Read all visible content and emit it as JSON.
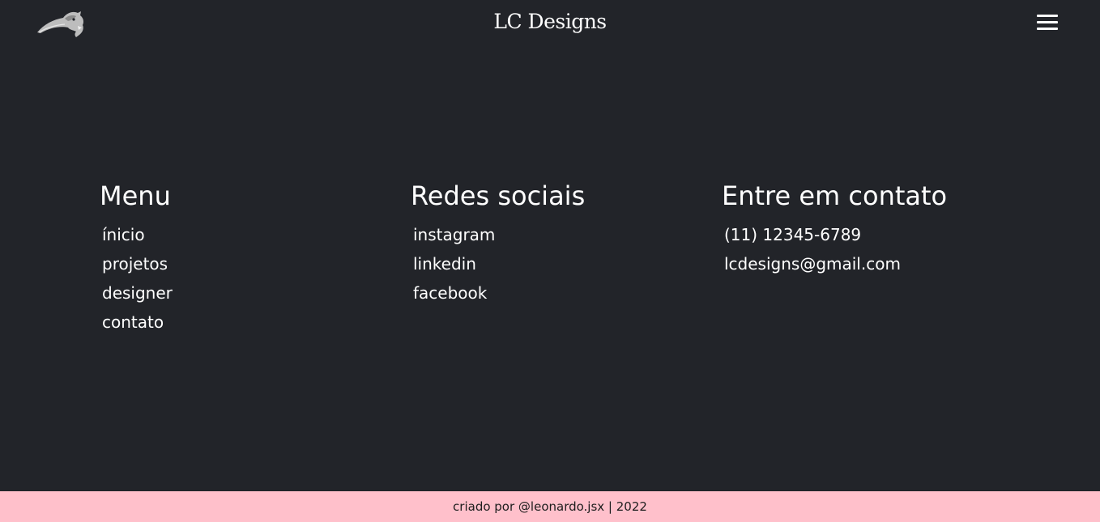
{
  "header": {
    "logo_icon": "panther-logo-icon",
    "title": "LC Designs",
    "menu_icon": "hamburger-menu-icon"
  },
  "menu": {
    "heading": "Menu",
    "items": [
      "ínicio",
      "projetos",
      "designer",
      "contato"
    ]
  },
  "social": {
    "heading": "Redes sociais",
    "items": [
      "instagram",
      "linkedin",
      "facebook"
    ]
  },
  "contact": {
    "heading": "Entre em contato",
    "phone": "(11) 12345-6789",
    "email": "lcdesigns@gmail.com"
  },
  "footer": {
    "text": "criado por @leonardo.jsx | 2022"
  },
  "colors": {
    "background": "#222429",
    "footer_background": "#ffc0cb",
    "text": "#ffffff"
  }
}
